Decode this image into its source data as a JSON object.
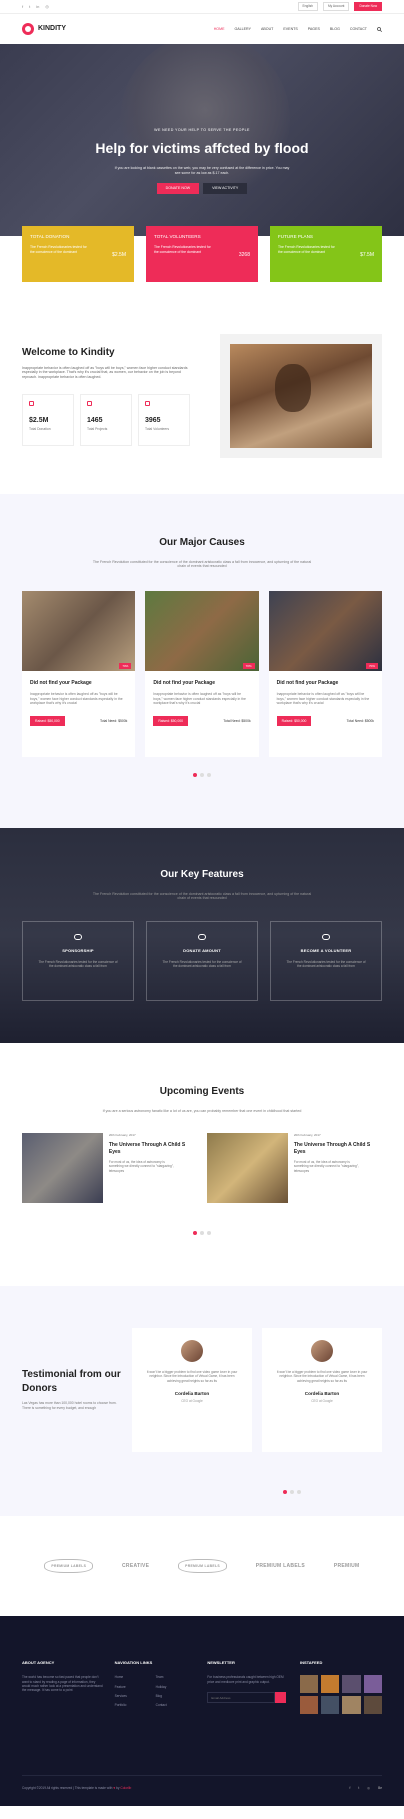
{
  "topbar": {
    "socials": [
      "f",
      "t",
      "in",
      "◎"
    ],
    "language": "English",
    "account": "My Account",
    "donate": "Donate Now"
  },
  "nav": {
    "brand": "KINDITY",
    "items": [
      "HOME",
      "GALLERY",
      "ABOUT",
      "EVENTS",
      "PAGES",
      "BLOG",
      "CONTACT"
    ],
    "search_icon": "search-icon"
  },
  "hero": {
    "kicker": "WE NEED YOUR HELP TO SERVE THE PEOPLE",
    "title": "Help for victims affcted by flood",
    "text": "If you are looking at blank cassettes on the web, you may be very confused at the difference in price. You may see some for as low as $.17 each.",
    "btn_primary": "DONATE NOW",
    "btn_secondary": "VIEW ACTIVITY"
  },
  "stats": [
    {
      "title": "TOTAL DONATION",
      "text": "The French Revolutionaries tested for the conscience of the dominant",
      "amount": "$2.5M",
      "color": "#e4b928"
    },
    {
      "title": "TOTAL VOLUNTEERS",
      "text": "The French Revolutionaries tested for the conscience of the dominant",
      "amount": "3268",
      "color": "#ee2c58"
    },
    {
      "title": "FUTURE PLANS",
      "text": "The French Revolutionaries tested for the conscience of the dominant",
      "amount": "$7.5M",
      "color": "#84c518"
    }
  ],
  "welcome": {
    "title": "Welcome to Kindity",
    "text": "Inappropriate behavior is often laughed off as \"boys will be boys,\" women face higher conduct standards especially in the workplace. That's why it's crucial that, as women, our behavior on the job is beyond reproach. inappropriate behavior is often laughed.",
    "minis": [
      {
        "value": "$2.5M",
        "label": "Total Donation"
      },
      {
        "value": "1465",
        "label": "Total Projects"
      },
      {
        "value": "3965",
        "label": "Total Volunteers"
      }
    ]
  },
  "causes": {
    "title": "Our Major Causes",
    "sub": "The French Revolution constituted for the conscience of the dominant aristocratic class a fall from innocence, and upturning of the natural chain of events that resounded",
    "items": [
      {
        "tag": "70%",
        "title": "Did not find your Package",
        "text": "Inappropriate behavior is often laughed off as \"boys will be boys,\" women face higher conduct standards especially in the workplace that's why it's crucial",
        "raised": "Raised: $50,000",
        "need": "Total Need: $500k"
      },
      {
        "tag": "70%",
        "title": "Did not find your Package",
        "text": "Inappropriate behavior is often laughed off as \"boys will be boys,\" women face higher conduct standards especially in the workplace that's why it's crucial",
        "raised": "Raised: $50,000",
        "need": "Total Need: $500k"
      },
      {
        "tag": "70%",
        "title": "Did not find your Package",
        "text": "Inappropriate behavior is often laughed off as \"boys will be boys,\" women face higher conduct standards especially in the workplace that's why it's crucial",
        "raised": "Raised: $50,000",
        "need": "Total Need: $500k"
      }
    ]
  },
  "features": {
    "title": "Our Key Features",
    "sub": "The French Revolution constituted for the conscience of the dominant aristocratic class a fall from innocence, and upturning of the natural chain of events that resounded",
    "items": [
      {
        "title": "SPONSORSHIP",
        "text": "The French Revolutionaries tested for the conscience of the dominant aristocratic class a fall from"
      },
      {
        "title": "DONATE AMOUNT",
        "text": "The French Revolutionaries tested for the conscience of the dominant aristocratic class a fall from"
      },
      {
        "title": "BECOME A VOLUNTEER",
        "text": "The French Revolutionaries tested for the conscience of the dominant aristocratic class a fall from"
      }
    ]
  },
  "events": {
    "title": "Upcoming Events",
    "sub": "If you are a serious astronomy fanatic like a lot of us are, you can probably remember that one event in childhood that started",
    "items": [
      {
        "date": "20th February, 2017",
        "title": "The Universe Through A Child S Eyes",
        "text": "For most of us, the idea of astronomy is something we directly connect to \"stargazing\", telescopes"
      },
      {
        "date": "20th February, 2017",
        "title": "The Universe Through A Child S Eyes",
        "text": "For most of us, the idea of astronomy is something we directly connect to \"stargazing\", telescopes"
      }
    ]
  },
  "testimonial": {
    "title": "Testimonial from our Donors",
    "text": "Las Vegas has more than 100,000 hotel rooms to choose from. There is something for every budget, and enough",
    "items": [
      {
        "quote": "It won't be a bigger problem to find one video game lover in your neighbor. Since the introduction of Virtual Game, it has been achieving great heights so far as its",
        "name": "Cordelia Barton",
        "role": "CEO at Google"
      },
      {
        "quote": "It won't be a bigger problem to find one video game lover in your neighbor. Since the introduction of Virtual Game, it has been achieving great heights so far as its",
        "name": "Cordelia Barton",
        "role": "CEO at Google"
      }
    ]
  },
  "clients": [
    "PREMIUM LABELS",
    "CREATIVE",
    "premium labels",
    "PREMIUM LABELS",
    "PREMIUM"
  ],
  "footer": {
    "about_title": "ABOUT AGENCY",
    "about_text": "The world has become so fast paced that people don't want to stand by reading a page of information, they would much rather look at a presentation and understand the message. It has come to a point",
    "nav_title": "NAVIGATION LINKS",
    "links": [
      "Home",
      "Team",
      "Feature",
      "Holiday",
      "Services",
      "Blog",
      "Portfolio",
      "Contact"
    ],
    "newsletter_title": "NEWSLETTER",
    "newsletter_text": "For business professionals caught between high OEM price and mediocre print and graphic output.",
    "email_placeholder": "Email Address",
    "insta_title": "INSTAFEED",
    "copyright_pre": "Copyright ©2019 All rights reserved | This template is made with ",
    "copyright_heart": "♥",
    "copyright_by": " by ",
    "copyright_brand": "Colorlib",
    "socials": [
      "f",
      "t",
      "◎",
      "Be"
    ]
  }
}
